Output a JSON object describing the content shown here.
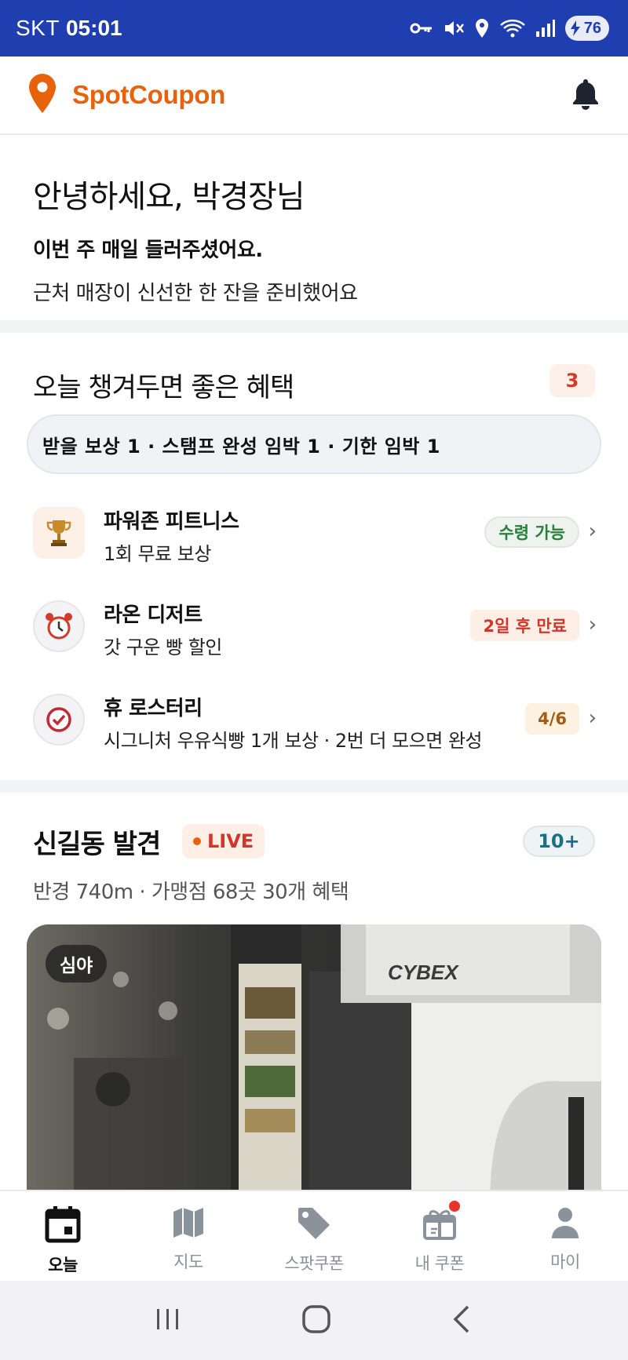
{
  "status_bar": {
    "carrier": "SKT",
    "time": "05:01",
    "battery": "76"
  },
  "app": {
    "brand": "SpotCoupon",
    "brand_color": "#e8620c"
  },
  "greeting": {
    "title": "안녕하세요, 박경장님",
    "strong": "이번 주 매일 들러주셨어요.",
    "sub": "근처 매장이 신선한 한 잔을 준비했어요"
  },
  "benefits": {
    "title": "오늘 챙겨두면 좋은 혜택",
    "count": "3",
    "summary": "받을 보상 1 · 스탬프 완성 임박 1 · 기한 임박 1",
    "items": [
      {
        "icon": "trophy-icon",
        "name": "파워존 피트니스",
        "desc": "1회 무료 보상",
        "badge": "수령 가능",
        "badge_color": "#27803c"
      },
      {
        "icon": "alarm-clock-icon",
        "name": "라온 디저트",
        "desc": "갓 구운 빵 할인",
        "badge": "2일 후 만료",
        "badge_color": "#d2352a"
      },
      {
        "icon": "check-circle-icon",
        "name": "휴 로스터리",
        "desc": "시그니처 우유식빵 1개 보상 · 2번 더 모으면 완성",
        "badge": "4/6",
        "badge_color": "#a9590e"
      }
    ]
  },
  "discover": {
    "title": "신길동 발견",
    "live": "LIVE",
    "count": "10+",
    "sub": "반경 740m · 가맹점 68곳 30개 혜택",
    "card_tag": "심야"
  },
  "bottom_nav": [
    {
      "label": "오늘",
      "icon": "calendar-icon",
      "active": true
    },
    {
      "label": "지도",
      "icon": "map-icon",
      "active": false
    },
    {
      "label": "스팟쿠폰",
      "icon": "tag-icon",
      "active": false
    },
    {
      "label": "내 쿠폰",
      "icon": "gift-icon",
      "active": false,
      "has_dot": true
    },
    {
      "label": "마이",
      "icon": "person-icon",
      "active": false
    }
  ]
}
